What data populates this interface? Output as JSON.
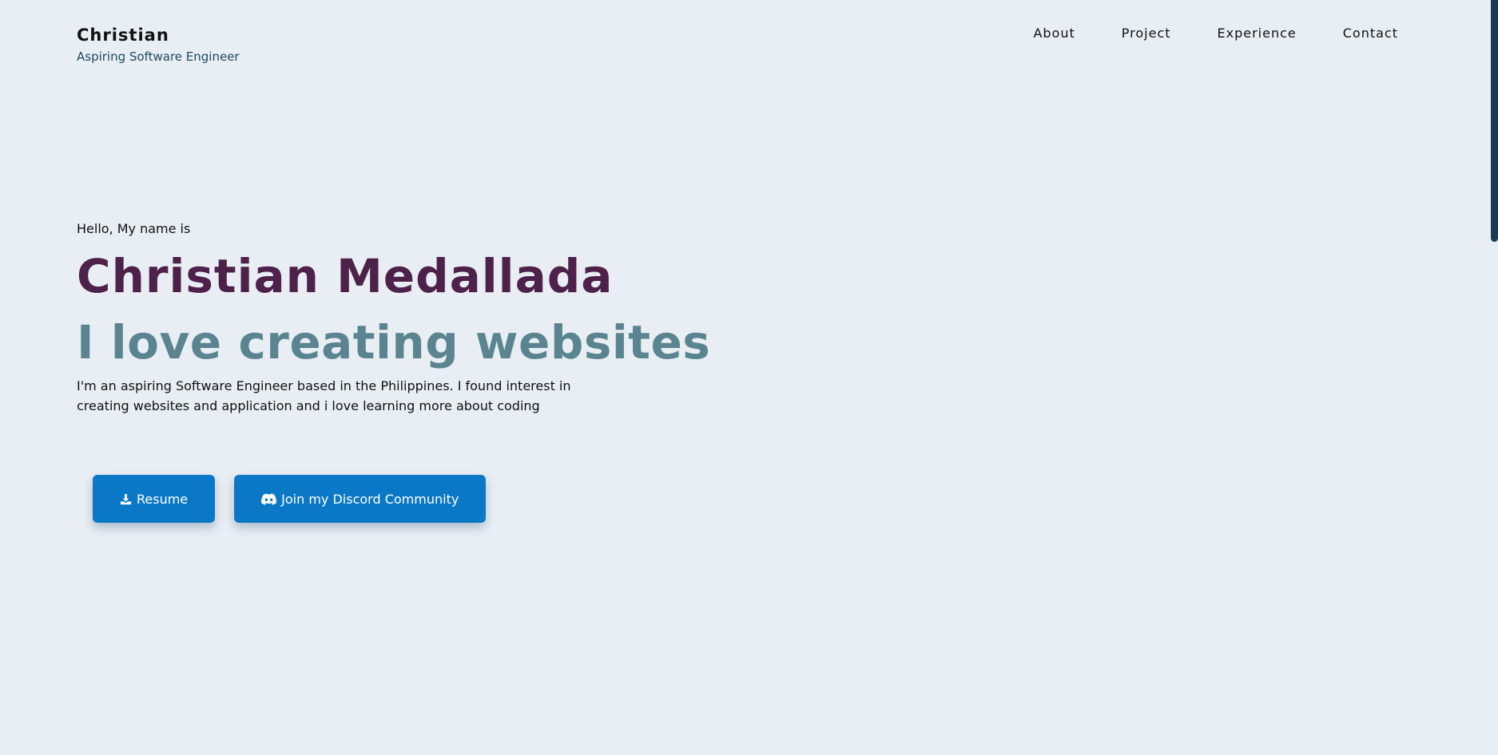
{
  "header": {
    "brand_name": "Christian",
    "brand_tagline": "Aspiring Software Engineer",
    "nav": [
      {
        "label": "About"
      },
      {
        "label": "Project"
      },
      {
        "label": "Experience"
      },
      {
        "label": "Contact"
      }
    ]
  },
  "hero": {
    "greeting": "Hello, My name is",
    "name": "Christian Medallada",
    "headline": "I love creating websites",
    "description": "I'm an aspiring Software Engineer based in the Philippines. I found interest in creating websites and application and i love learning more about coding",
    "buttons": {
      "resume_label": "Resume",
      "resume_icon": "download-icon",
      "discord_label": "Join my Discord Community",
      "discord_icon": "discord-icon"
    }
  },
  "colors": {
    "background": "#e8eef3",
    "name_accent": "#4d2149",
    "headline_accent": "#5a8590",
    "button": "#0b78c7",
    "scrollbar_thumb": "#1b3a56"
  }
}
